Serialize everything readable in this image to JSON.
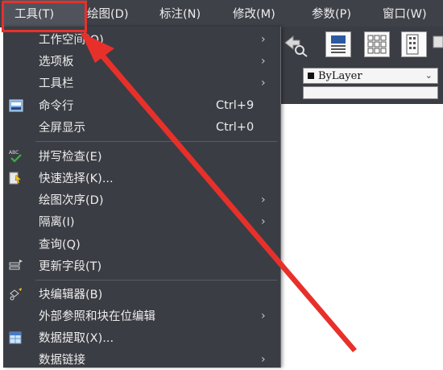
{
  "menubar": {
    "items": [
      {
        "label": "工具(T)"
      },
      {
        "label": "绘图(D)"
      },
      {
        "label": "标注(N)"
      },
      {
        "label": "修改(M)"
      },
      {
        "label": "参数(P)"
      },
      {
        "label": "窗口(W)"
      }
    ]
  },
  "properties": {
    "layer_value": "ByLayer"
  },
  "dropdown": {
    "items": [
      {
        "label": "工作空间(O)",
        "shortcut": "",
        "submenu": true
      },
      {
        "label": "选项板",
        "shortcut": "",
        "submenu": true
      },
      {
        "label": "工具栏",
        "shortcut": "",
        "submenu": true
      },
      {
        "label": "命令行",
        "shortcut": "Ctrl+9",
        "submenu": false
      },
      {
        "label": "全屏显示",
        "shortcut": "Ctrl+0",
        "submenu": false
      },
      {
        "label": "拼写检查(E)",
        "shortcut": "",
        "submenu": false
      },
      {
        "label": "快速选择(K)...",
        "shortcut": "",
        "submenu": false
      },
      {
        "label": "绘图次序(D)",
        "shortcut": "",
        "submenu": true
      },
      {
        "label": "隔离(I)",
        "shortcut": "",
        "submenu": true
      },
      {
        "label": "查询(Q)",
        "shortcut": "",
        "submenu": true
      },
      {
        "label": "更新字段(T)",
        "shortcut": "",
        "submenu": false
      },
      {
        "label": "块编辑器(B)",
        "shortcut": "",
        "submenu": false
      },
      {
        "label": "外部参照和块在位编辑",
        "shortcut": "",
        "submenu": true
      },
      {
        "label": "数据提取(X)...",
        "shortcut": "",
        "submenu": false
      },
      {
        "label": "数据链接",
        "shortcut": "",
        "submenu": true
      }
    ]
  },
  "colors": {
    "highlight": "#e8302a",
    "menubar": "#3f4149",
    "dropdown": "#3b3d44"
  }
}
